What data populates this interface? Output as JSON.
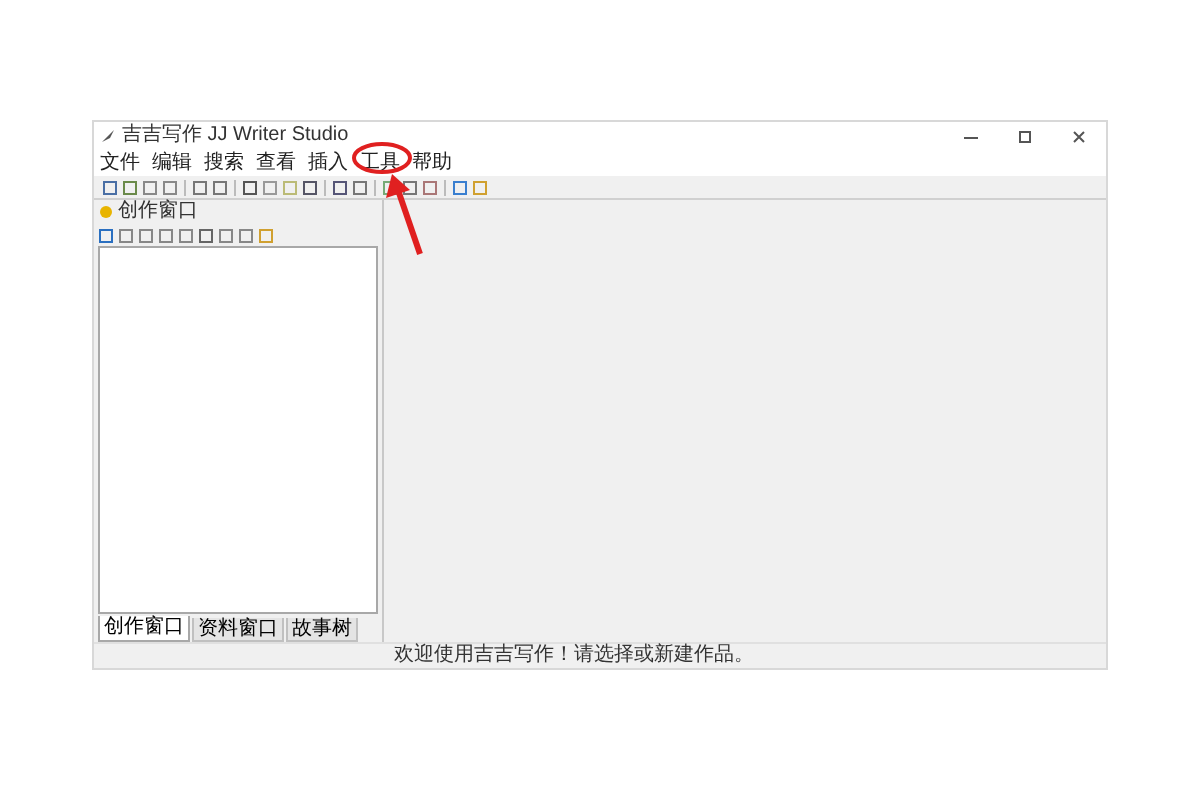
{
  "window": {
    "title": "吉吉写作 JJ Writer Studio"
  },
  "menu": [
    "文件",
    "编辑",
    "搜索",
    "查看",
    "插入",
    "工具",
    "帮助"
  ],
  "left_panel": {
    "title": "创作窗口",
    "tabs": [
      {
        "label": "创作窗口",
        "selected": true
      },
      {
        "label": "资料窗口",
        "selected": false
      },
      {
        "label": "故事树",
        "selected": false
      }
    ]
  },
  "status_bar": "欢迎使用吉吉写作！请选择或新建作品。"
}
